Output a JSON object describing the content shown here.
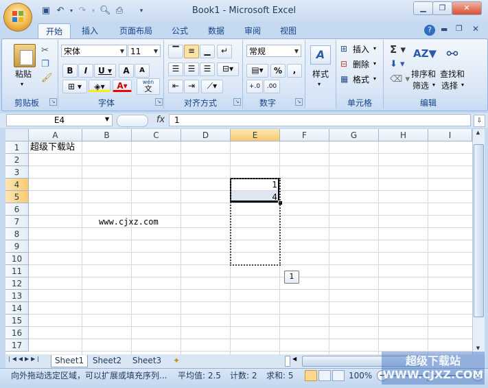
{
  "window": {
    "title": "Book1 - Microsoft Excel"
  },
  "tabs": [
    "开始",
    "插入",
    "页面布局",
    "公式",
    "数据",
    "审阅",
    "视图"
  ],
  "ribbon": {
    "clipboard": {
      "paste": "粘贴",
      "label": "剪贴板"
    },
    "font": {
      "name": "宋体",
      "size": "11",
      "label": "字体",
      "wen_label": "wén",
      "wen_char": "文"
    },
    "alignment": {
      "label": "对齐方式"
    },
    "number": {
      "format": "常规",
      "label": "数字",
      "percent": "%",
      "comma": ","
    },
    "styles": {
      "label": "样式"
    },
    "cells": {
      "insert": "插入",
      "delete": "删除",
      "format": "格式",
      "label": "单元格"
    },
    "editing": {
      "sort": "排序和",
      "sort2": "筛选",
      "find": "查找和",
      "find2": "选择",
      "label": "编辑"
    }
  },
  "formula_bar": {
    "name_box": "E4",
    "fx": "fx",
    "value": "1"
  },
  "columns": [
    "A",
    "B",
    "C",
    "D",
    "E",
    "F",
    "G",
    "H",
    "I"
  ],
  "rows": [
    "1",
    "2",
    "3",
    "4",
    "5",
    "6",
    "7",
    "8",
    "9",
    "10",
    "11",
    "12",
    "13",
    "14",
    "15",
    "16",
    "17"
  ],
  "cells": {
    "A1": "超级下载站",
    "B7": "www.cjxz.com",
    "E4": "1",
    "E5": "4"
  },
  "autofill_tooltip": "1",
  "sheets": [
    "Sheet1",
    "Sheet2",
    "Sheet3"
  ],
  "status": {
    "message": "向外拖动选定区域，可以扩展或填充序列...",
    "average": "平均值: 2.5",
    "count": "计数: 2",
    "sum": "求和: 5",
    "zoom": "100%"
  },
  "watermark": "超级下载站 WWW.CJXZ.COM",
  "colors": {
    "ribbon": "#dbe7f6",
    "accent": "#15428b",
    "selection": "#f9c96f"
  }
}
